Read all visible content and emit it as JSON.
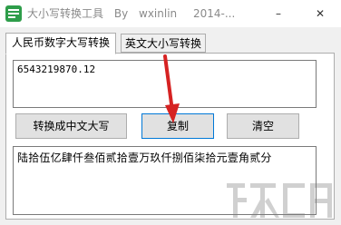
{
  "window": {
    "title_name": "大小写转换工具",
    "title_by": "By",
    "title_author": "wxinlin",
    "title_year": "2014-...",
    "minimize_glyph": "–",
    "close_glyph": "✕"
  },
  "tabs": [
    {
      "label": "人民币数字大写转换",
      "active": true
    },
    {
      "label": "英文大小写转换",
      "active": false
    }
  ],
  "input": {
    "value": "6543219870.12"
  },
  "buttons": {
    "convert_label": "转换成中文大写",
    "copy_label": "复制",
    "clear_label": "清空"
  },
  "output": {
    "value": "陆拾伍亿肆仟叁佰贰拾壹万玖仟捌佰柒拾元壹角贰分"
  },
  "colors": {
    "accent": "#0078d7",
    "arrow": "#d62222",
    "icon": "#2e9d4a"
  }
}
